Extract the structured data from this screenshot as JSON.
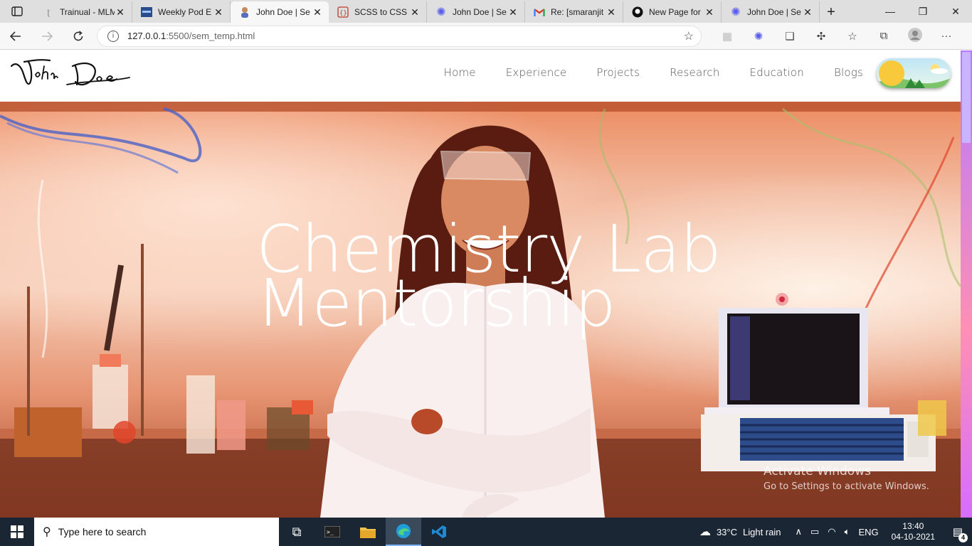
{
  "browser": {
    "tabs": [
      {
        "title": "Trainual - MLM",
        "icon": "trainual-icon",
        "active": false
      },
      {
        "title": "Weekly Pod E",
        "icon": "pod-icon",
        "active": false
      },
      {
        "title": "John Doe | Se",
        "icon": "avatar-icon",
        "active": true
      },
      {
        "title": "SCSS to CSS C",
        "icon": "scss-icon",
        "active": false
      },
      {
        "title": "John Doe | Se",
        "icon": "flower-icon",
        "active": false
      },
      {
        "title": "Re: [smaranjit",
        "icon": "gmail-icon",
        "active": false
      },
      {
        "title": "New Page for",
        "icon": "github-icon",
        "active": false
      },
      {
        "title": "John Doe | Se",
        "icon": "flower-icon",
        "active": false
      }
    ],
    "address": {
      "host": "127.0.0.1",
      "path": ":5500/sem_temp.html"
    }
  },
  "site": {
    "logo_text": "John Doe",
    "nav": [
      "Home",
      "Experience",
      "Projects",
      "Research",
      "Education",
      "Blogs"
    ],
    "hero": {
      "line1": "Chemistry Lab",
      "line2": "Mentorship"
    }
  },
  "watermark": {
    "title": "Activate Windows",
    "subtitle": "Go to Settings to activate Windows."
  },
  "taskbar": {
    "search_placeholder": "Type here to search",
    "weather": {
      "temp": "33°C",
      "condition": "Light rain"
    },
    "language": "ENG",
    "time": "13:40",
    "date": "04-10-2021",
    "notifications": "4"
  }
}
